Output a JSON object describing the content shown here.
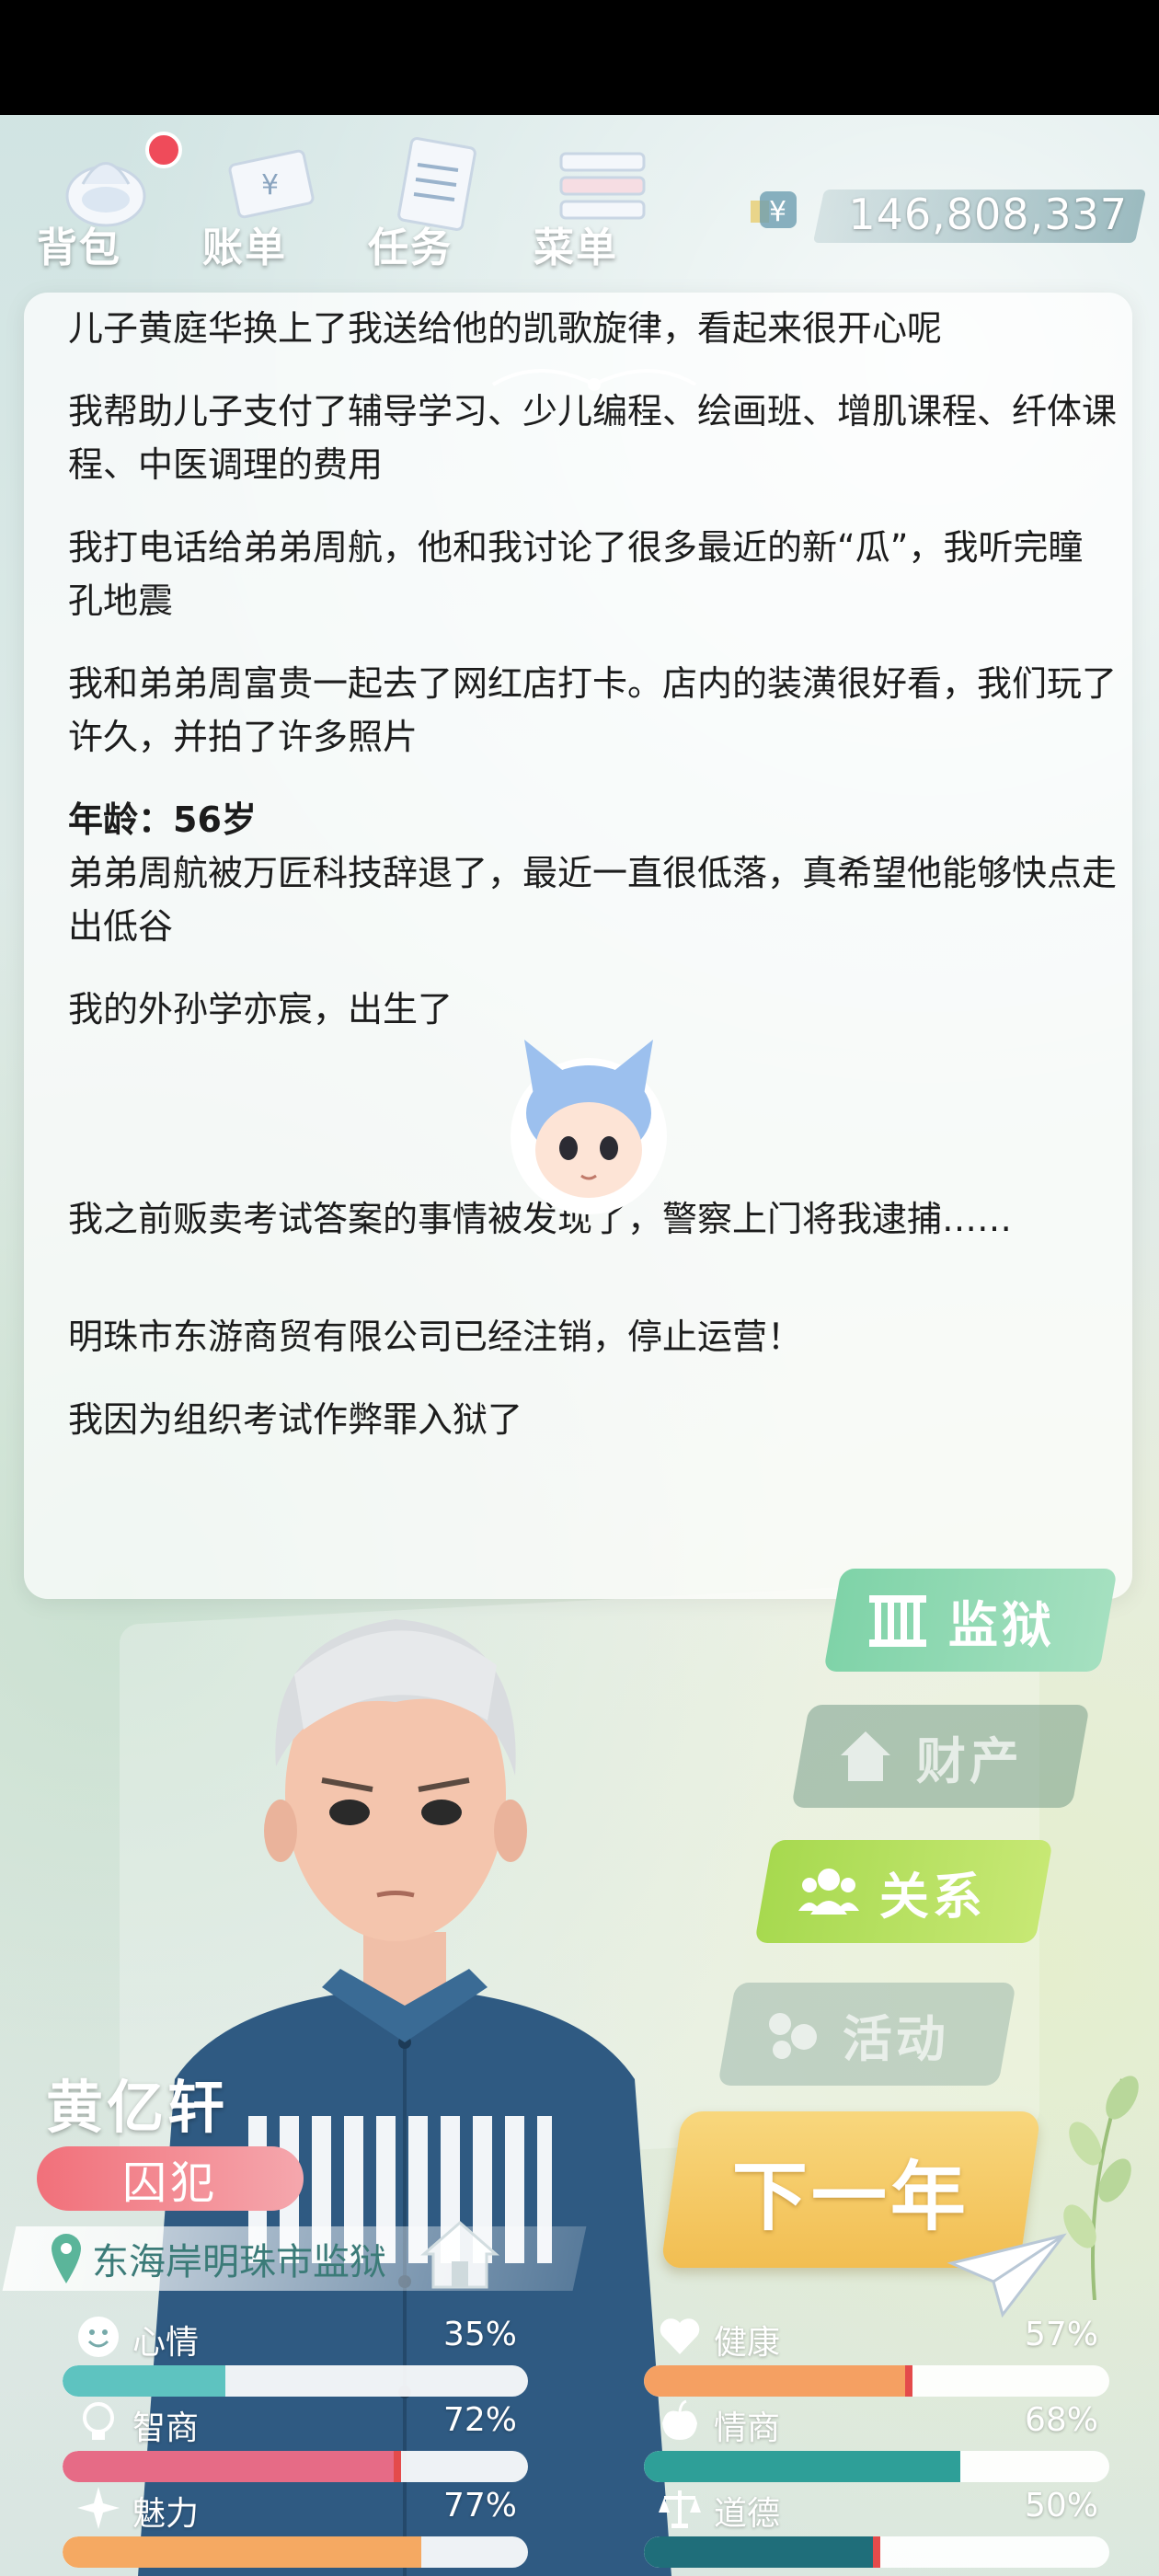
{
  "toolbar": {
    "backpack_label": "背包",
    "bill_label": "账单",
    "task_label": "任务",
    "menu_label": "菜单",
    "bill_symbol": "¥"
  },
  "money": {
    "symbol": "¥",
    "value": "146,808,337"
  },
  "log": {
    "entries_top": [
      "儿子黄庭华换上了我送给他的凯歌旋律，看起来很开心呢",
      "我帮助儿子支付了辅导学习、少儿编程、绘画班、增肌课程、纤体课程、中医调理的费用",
      "我打电话给弟弟周航，他和我讨论了很多最近的新“瓜”，我听完瞳孔地震",
      "我和弟弟周富贵一起去了网红店打卡。店内的装潢很好看，我们玩了许久，并拍了许多照片"
    ],
    "age_title": "年龄：56岁",
    "entries_age": [
      "弟弟周航被万匠科技辞退了，最近一直很低落，真希望他能够快点走出低谷",
      "我的外孙学亦宸，出生了",
      "我之前贩卖考试答案的事情被发现了，警察上门将我逮捕……",
      "明珠市东游商贸有限公司已经注销，停止运营！",
      "我因为组织考试作弊罪入狱了"
    ]
  },
  "actions": {
    "prison": "监狱",
    "property": "财产",
    "relation": "关系",
    "activity": "活动",
    "next_year": "下一年"
  },
  "character": {
    "name": "黄亿轩",
    "status": "囚犯",
    "location": "东海岸明珠市监狱"
  },
  "stats": [
    {
      "label": "心情",
      "value": "35%",
      "level": 0.35,
      "icon": "smile-icon",
      "color": "#5ec3c0"
    },
    {
      "label": "健康",
      "value": "57%",
      "level": 0.57,
      "icon": "heart-icon",
      "color": "#f5a062"
    },
    {
      "label": "智商",
      "value": "72%",
      "level": 0.72,
      "icon": "bulb-icon",
      "color": "#e66b86"
    },
    {
      "label": "情商",
      "value": "68%",
      "level": 0.68,
      "icon": "apple-icon",
      "color": "#2e9f98"
    },
    {
      "label": "魅力",
      "value": "77%",
      "level": 0.77,
      "icon": "sparkle-icon",
      "color": "#f5a962"
    },
    {
      "label": "道德",
      "value": "50%",
      "level": 0.5,
      "icon": "scale-icon",
      "color": "#1f6e7a"
    }
  ],
  "colors": {
    "prison_button": "#7fd3a8",
    "relation_button": "#a7d94f",
    "next_year_button": "#f5c862",
    "status_tag": "#f1707a",
    "location_text": "#3b7b78"
  }
}
